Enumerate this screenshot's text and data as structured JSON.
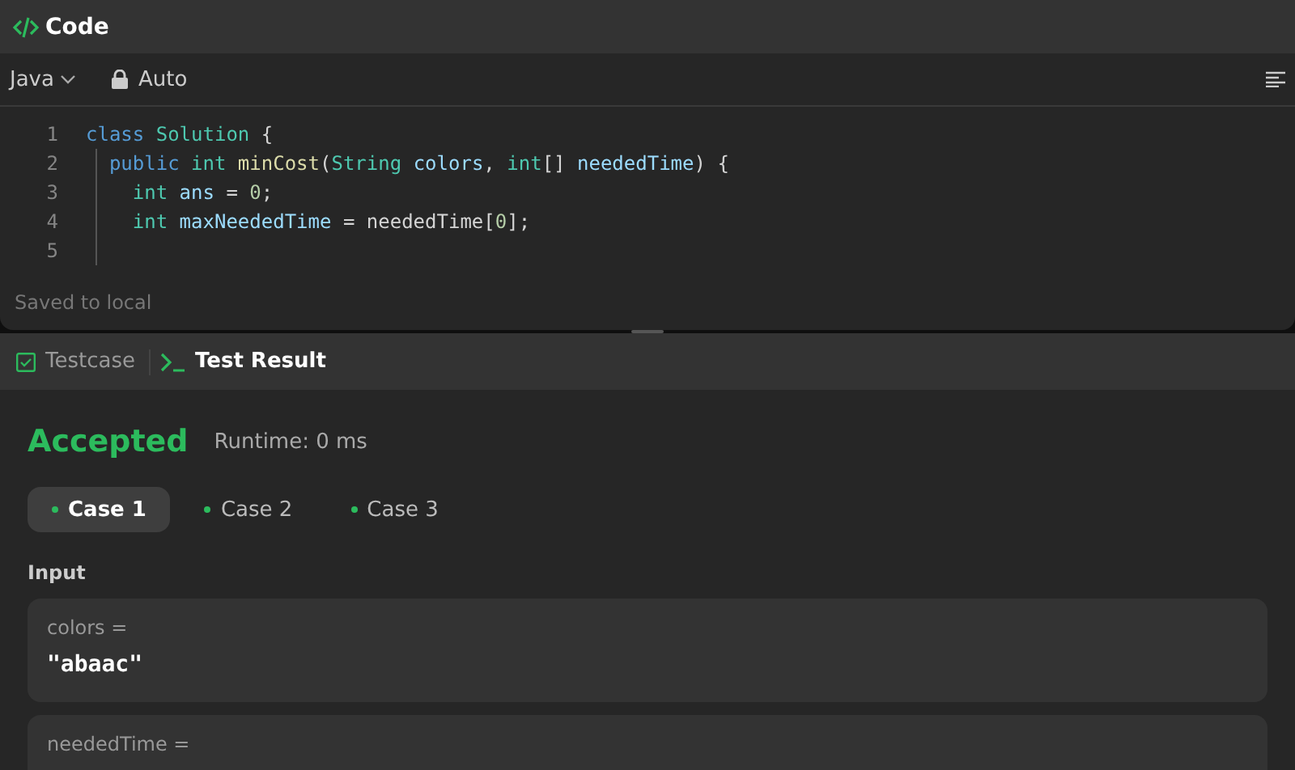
{
  "code_panel": {
    "title": "Code",
    "language": "Java",
    "mode": "Auto",
    "lines": [
      {
        "number": "1",
        "tokens": [
          {
            "text": "class",
            "kind": "keyword"
          },
          {
            "text": " Solution",
            "kind": "type"
          },
          {
            "text": " {",
            "kind": "plain"
          }
        ]
      },
      {
        "number": "2",
        "tokens": [
          {
            "text": "  public",
            "kind": "keyword"
          },
          {
            "text": " int",
            "kind": "type"
          },
          {
            "text": " minCost",
            "kind": "method"
          },
          {
            "text": "(",
            "kind": "plain"
          },
          {
            "text": "String",
            "kind": "type"
          },
          {
            "text": " colors",
            "kind": "variable"
          },
          {
            "text": ", ",
            "kind": "plain"
          },
          {
            "text": "int",
            "kind": "type"
          },
          {
            "text": "[] ",
            "kind": "plain"
          },
          {
            "text": "neededTime",
            "kind": "variable"
          },
          {
            "text": ") {",
            "kind": "plain"
          }
        ]
      },
      {
        "number": "3",
        "tokens": [
          {
            "text": "    int",
            "kind": "type"
          },
          {
            "text": " ans",
            "kind": "variable"
          },
          {
            "text": " = ",
            "kind": "plain"
          },
          {
            "text": "0",
            "kind": "number"
          },
          {
            "text": ";",
            "kind": "plain"
          }
        ]
      },
      {
        "number": "4",
        "tokens": [
          {
            "text": "    int",
            "kind": "type"
          },
          {
            "text": " maxNeededTime",
            "kind": "variable"
          },
          {
            "text": " = neededTime[",
            "kind": "plain"
          },
          {
            "text": "0",
            "kind": "number"
          },
          {
            "text": "];",
            "kind": "plain"
          }
        ]
      },
      {
        "number": "5"
      }
    ],
    "status": "Saved to local"
  },
  "result_panel": {
    "tabs": [
      {
        "label": "Testcase",
        "kind": "testcase",
        "selected": false
      },
      {
        "label": "Test Result",
        "kind": "result",
        "selected": true
      }
    ],
    "verdict": "Accepted",
    "runtime": "Runtime: 0 ms",
    "cases": [
      {
        "label": "Case 1",
        "selected": true
      },
      {
        "label": "Case 2",
        "selected": false
      },
      {
        "label": "Case 3",
        "selected": false
      }
    ],
    "input_heading": "Input",
    "params": [
      {
        "name": "colors =",
        "value": "\"abaac\""
      },
      {
        "name": "neededTime ="
      }
    ]
  }
}
